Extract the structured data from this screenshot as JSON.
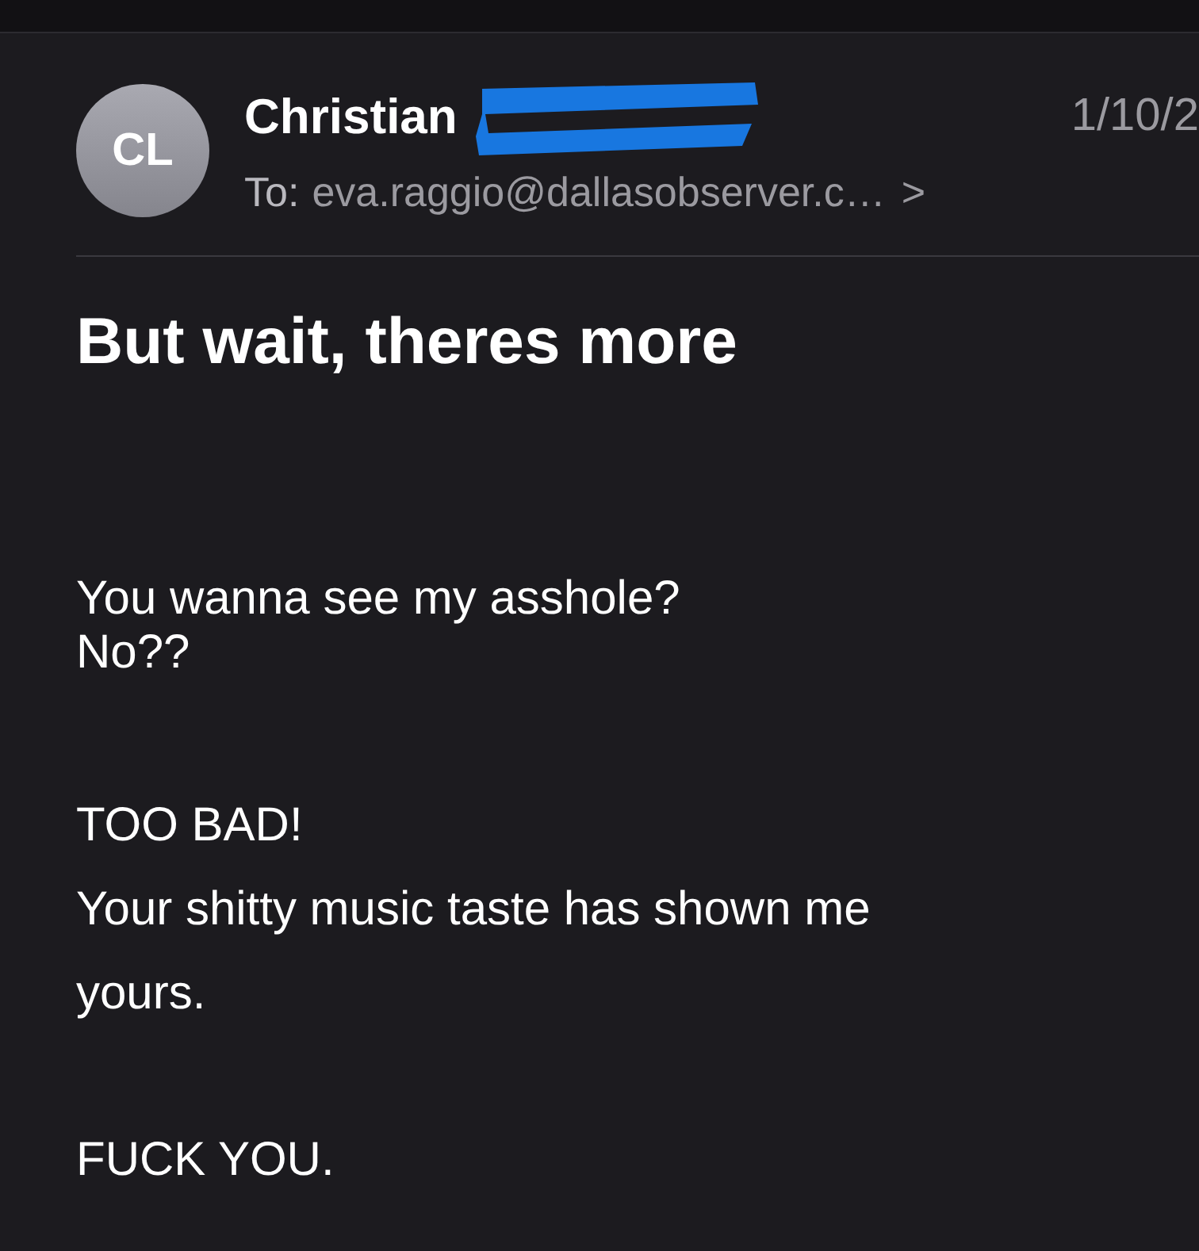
{
  "message": {
    "sender": {
      "initials": "CL",
      "name": "Christian",
      "redacted": true
    },
    "date": "1/10/2",
    "to_label": "To:",
    "to_address": "eva.raggio@dallasobserver.c…",
    "chevron": ">",
    "subject": "But wait, theres more",
    "body": [
      [
        "You wanna see my asshole?",
        "No??"
      ],
      [
        "TOO BAD!",
        "Your shitty music taste has shown me",
        "yours."
      ],
      [
        "FUCK YOU."
      ]
    ]
  }
}
